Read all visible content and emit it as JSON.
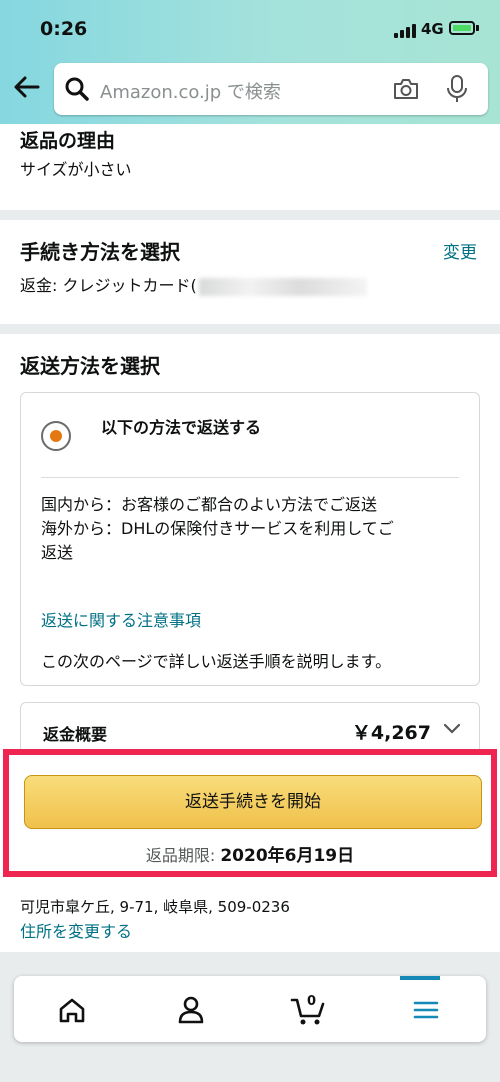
{
  "status": {
    "time": "0:26",
    "network": "4G"
  },
  "search": {
    "placeholder": "Amazon.co.jp で検索"
  },
  "return_reason": {
    "title": "返品の理由",
    "value": "サイズが小さい"
  },
  "refund_method": {
    "title": "手続き方法を選択",
    "change": "変更",
    "value": "返金: クレジットカード("
  },
  "return_method": {
    "title": "返送方法を選択",
    "option_label": "以下の方法で返送する",
    "desc_lines": [
      "国内から：お客様のご都合のよい方法でご返送",
      "海外から：DHLの保険付きサービスを利用してご",
      "返送"
    ],
    "notice_link": "返送に関する注意事項",
    "next_info": "この次のページで詳しい返送手順を説明します。"
  },
  "refund_summary": {
    "label": "返金概要",
    "amount": "￥4,267"
  },
  "cta": {
    "label": "返送手続きを開始",
    "deadline_label": "返品期限: ",
    "deadline_date": "2020年6月19日"
  },
  "address": {
    "value": "可児市皐ケ丘, 9-71, 岐阜県, 509-0236",
    "change_link": "住所を変更する"
  },
  "nav": {
    "cart_count": "0",
    "items": [
      "home-icon",
      "account-icon",
      "cart-icon",
      "menu-icon"
    ]
  },
  "colors": {
    "link": "#007185",
    "cta": "#f0c14b",
    "highlight": "#ee2550",
    "radio": "#e47911"
  }
}
